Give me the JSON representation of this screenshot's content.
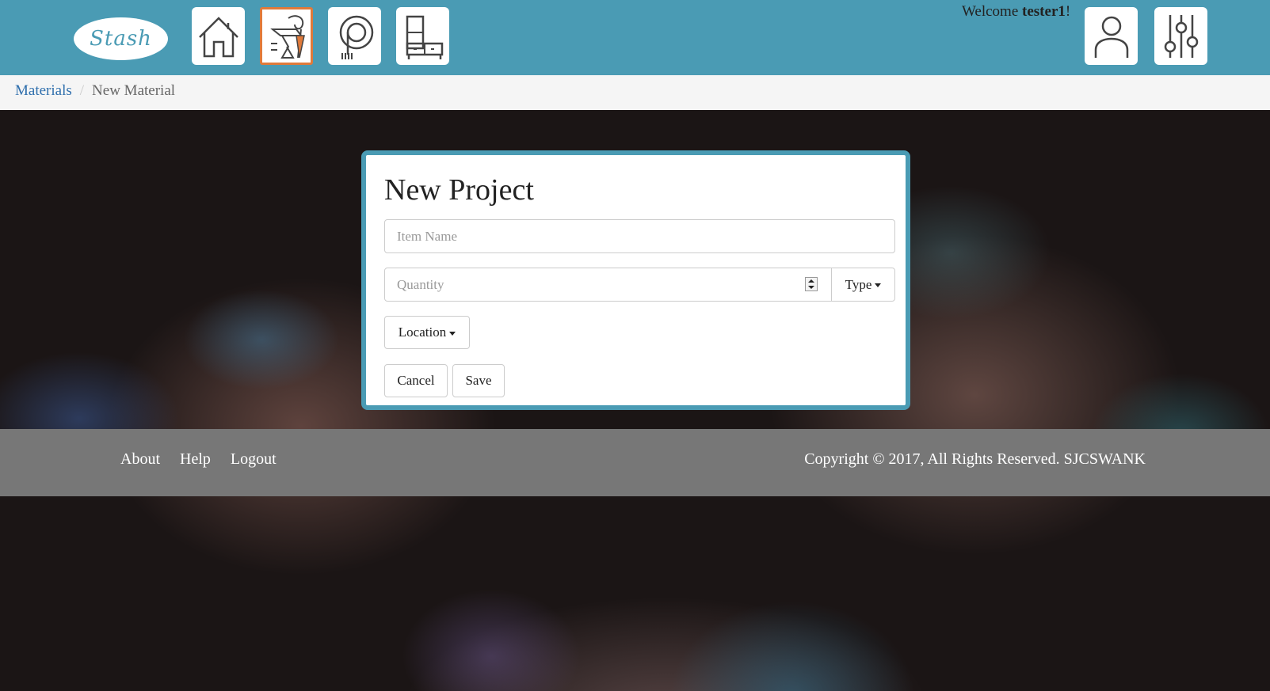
{
  "header": {
    "logo_text": "Stash",
    "nav": [
      {
        "name": "home",
        "icon": "home-icon"
      },
      {
        "name": "materials",
        "icon": "sewing-tools-icon",
        "active": true
      },
      {
        "name": "projects",
        "icon": "project-icon"
      },
      {
        "name": "storage",
        "icon": "cabinet-icon"
      }
    ],
    "welcome_prefix": "Welcome ",
    "username": "tester1",
    "welcome_suffix": "!",
    "right_icons": [
      "user-icon",
      "settings-sliders-icon"
    ]
  },
  "breadcrumb": {
    "items": [
      {
        "label": "Materials",
        "link": true
      },
      {
        "label": "New Material",
        "link": false
      }
    ]
  },
  "form": {
    "title": "New Project",
    "item_name_placeholder": "Item Name",
    "quantity_placeholder": "Quantity",
    "type_label": "Type",
    "location_label": "Location",
    "cancel_label": "Cancel",
    "save_label": "Save"
  },
  "footer": {
    "links": [
      "About",
      "Help",
      "Logout"
    ],
    "copyright": "Copyright © 2017, All Rights Reserved. SJCSWANK"
  },
  "colors": {
    "brand": "#4a9bb4",
    "active_border": "#e07a3a",
    "footer": "#777777",
    "link": "#2f6fad"
  }
}
